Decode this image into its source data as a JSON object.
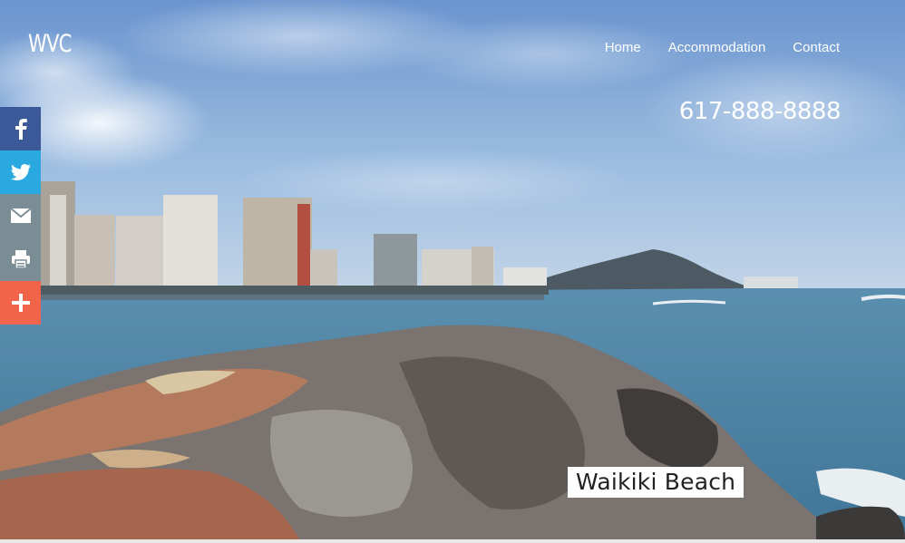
{
  "header": {
    "logo": "WVC",
    "nav": [
      {
        "label": "Home"
      },
      {
        "label": "Accommodation"
      },
      {
        "label": "Contact"
      }
    ],
    "phone": "617-888-8888"
  },
  "share_bar": {
    "buttons": [
      {
        "icon": "facebook-icon",
        "color": "#3b5998"
      },
      {
        "icon": "twitter-icon",
        "color": "#29a9e0"
      },
      {
        "icon": "email-icon",
        "color": "#7b8d94"
      },
      {
        "icon": "print-icon",
        "color": "#7b8d94"
      },
      {
        "icon": "plus-icon",
        "color": "#f26449"
      }
    ]
  },
  "hero": {
    "caption": "Waikiki Beach"
  }
}
